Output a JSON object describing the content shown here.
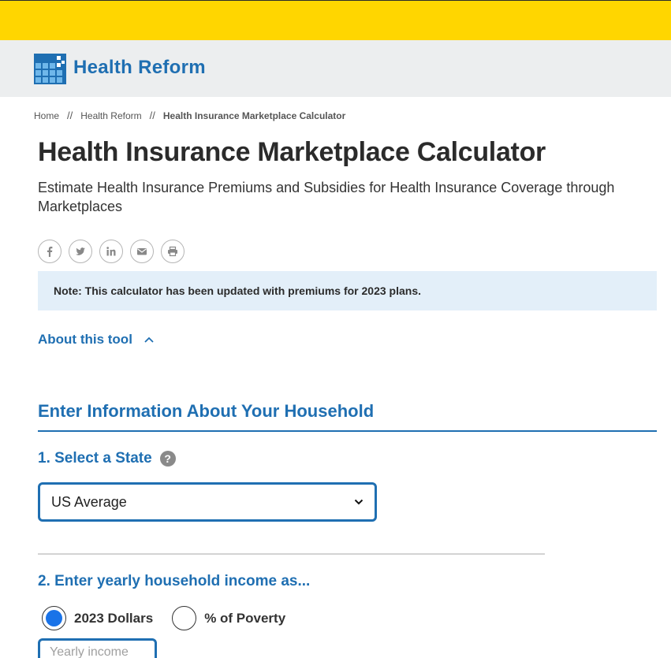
{
  "colors": {
    "yellow": "#ffd600",
    "brand_blue": "#1f6fb2",
    "note_bg": "#e3eff9",
    "radio_blue": "#1a73e8"
  },
  "brand": {
    "title": "Health Reform",
    "logo_icon": "grid-logo-icon"
  },
  "breadcrumb": {
    "home": "Home",
    "separator": "//",
    "section": "Health Reform",
    "current": "Health Insurance Marketplace Calculator"
  },
  "page": {
    "title": "Health Insurance Marketplace Calculator",
    "subtitle": "Estimate Health Insurance Premiums and Subsidies for Health Insurance Coverage through Marketplaces"
  },
  "share": {
    "icons": [
      "facebook-icon",
      "twitter-icon",
      "linkedin-icon",
      "email-icon",
      "print-icon"
    ]
  },
  "note": {
    "text": "Note: This calculator has been updated with premiums for 2023 plans."
  },
  "about": {
    "label": "About this tool"
  },
  "form": {
    "section_title": "Enter Information About Your Household",
    "step1": {
      "label": "1. Select a State",
      "help": "?",
      "selected": "US Average"
    },
    "step2": {
      "label": "2. Enter yearly household income as...",
      "options": [
        {
          "label": "2023 Dollars",
          "checked": true
        },
        {
          "label": "% of Poverty",
          "checked": false
        }
      ],
      "input_placeholder": "Yearly income"
    }
  }
}
